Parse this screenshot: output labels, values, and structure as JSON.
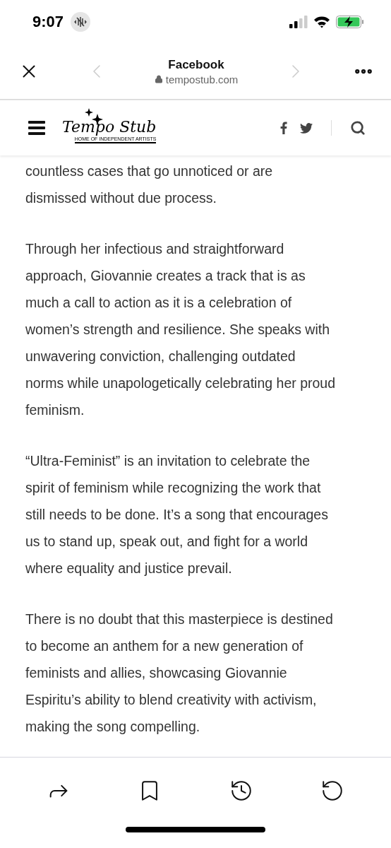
{
  "status_bar": {
    "time": "9:07"
  },
  "browser_bar": {
    "title": "Facebook",
    "url": "tempostub.com"
  },
  "site_header": {
    "logo": {
      "name": "Tempo Stub",
      "tagline": "HOME OF INDEPENDENT ARTISTS"
    }
  },
  "article": {
    "paragraphs": [
      {
        "lines": [
          "countless cases that go unnoticed or are",
          "dismissed without due process."
        ]
      },
      {
        "lines": [
          "Through her infectious and straightforward",
          "approach, Giovannie creates a track that is as",
          "much a call to action as it is a celebration of",
          "women’s strength and resilience. She speaks with",
          "unwavering conviction, challenging outdated",
          "norms while unapologetically celebrating her proud",
          "feminism."
        ]
      },
      {
        "lines": [
          "“Ultra-Feminist” is an invitation to celebrate the",
          "spirit of feminism while recognizing the work that",
          "still needs to be done. It’s a song that encourages",
          "us to stand up, speak out, and fight for a world",
          "where equality and justice prevail."
        ]
      },
      {
        "lines": [
          "There is no doubt that this masterpiece is destined",
          "to become an anthem for a new generation of",
          "feminists and allies, showcasing Giovannie",
          "Espiritu’s ability to blend creativity with activism,",
          "making the song compelling."
        ]
      }
    ]
  }
}
